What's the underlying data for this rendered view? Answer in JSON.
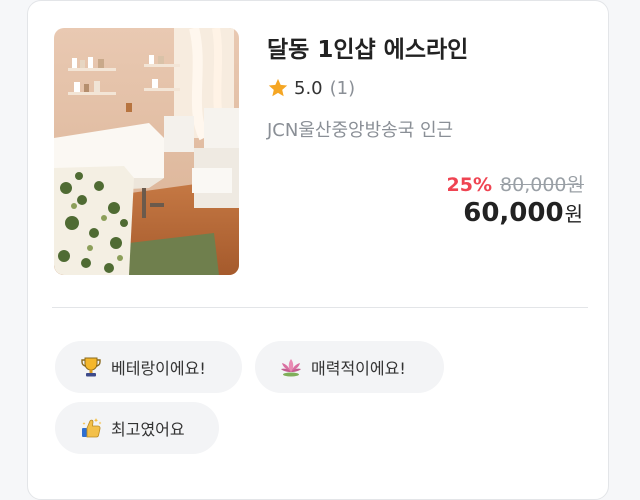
{
  "shop": {
    "name": "달동 1인샵 에스라인",
    "rating": "5.0",
    "review_count": "(1)",
    "location": "JCN울산중앙방송국 인근",
    "discount": "25%",
    "original_price": "80,000원",
    "price": "60,000",
    "price_unit": "원"
  },
  "tags": [
    {
      "label": "베테랑이에요!",
      "icon": "trophy-icon"
    },
    {
      "label": "매력적이에요!",
      "icon": "lotus-icon"
    },
    {
      "label": "최고였어요",
      "icon": "thumbs-up-icon"
    }
  ],
  "colors": {
    "discount": "#ef4452",
    "star": "#f5a623",
    "muted": "#8a8f96"
  }
}
